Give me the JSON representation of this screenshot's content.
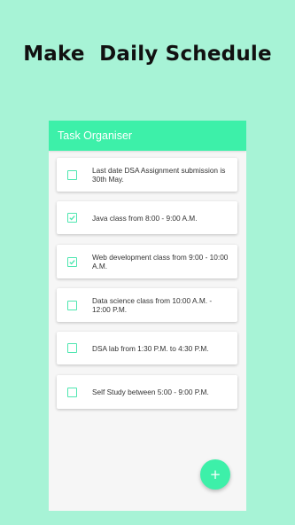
{
  "headline": "Make  Daily Schedule",
  "app": {
    "title": "Task Organiser",
    "fab_icon": "plus-icon",
    "fab_symbol": "+"
  },
  "colors": {
    "background": "#a7f3d6",
    "accent": "#3df0a9",
    "checkbox": "#4ee6b0"
  },
  "tasks": [
    {
      "text": "Last date DSA Assignment submission is 30th May.",
      "checked": false
    },
    {
      "text": "Java class from 8:00 - 9:00 A.M.",
      "checked": true
    },
    {
      "text": "Web development class from 9:00 -  10:00 A.M.",
      "checked": true
    },
    {
      "text": "Data science class from 10:00 A.M. - 12:00 P.M.",
      "checked": false
    },
    {
      "text": "DSA lab from 1:30 P.M. to 4:30 P.M.",
      "checked": false
    },
    {
      "text": "Self Study between 5:00 - 9:00 P.M.",
      "checked": false
    }
  ]
}
